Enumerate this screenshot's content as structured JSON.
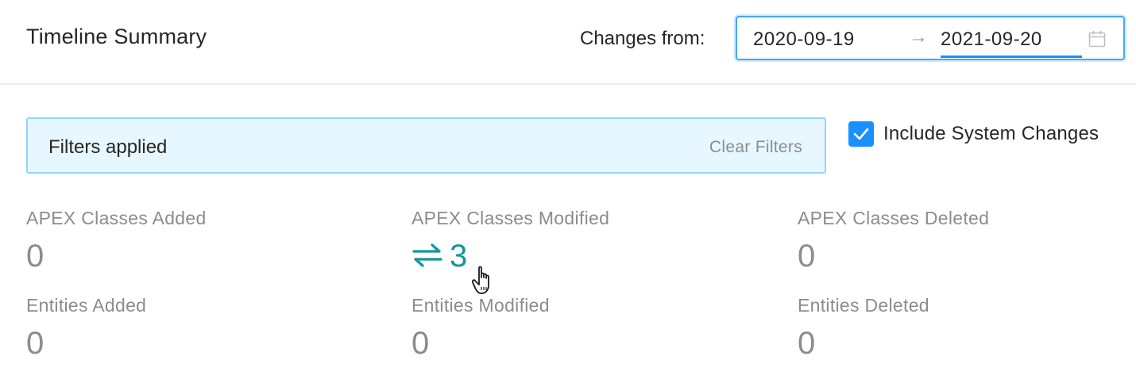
{
  "header": {
    "title": "Timeline Summary",
    "changes_label": "Changes from:",
    "range": {
      "start": "2020-09-19",
      "separator": "→",
      "end": "2021-09-20",
      "icon": "calendar-icon"
    }
  },
  "filters": {
    "message": "Filters applied",
    "clear_label": "Clear Filters"
  },
  "system_changes": {
    "label": "Include System Changes",
    "checked": true
  },
  "stats": [
    {
      "title": "APEX Classes Added",
      "value": "0"
    },
    {
      "title": "APEX Classes Modified",
      "value": "3",
      "icon": "swap-arrows-icon",
      "color": "#13959b"
    },
    {
      "title": "APEX Classes Deleted",
      "value": "0"
    },
    {
      "title": "Entities Added",
      "value": "0"
    },
    {
      "title": "Entities Modified",
      "value": "0"
    },
    {
      "title": "Entities Deleted",
      "value": "0"
    }
  ],
  "colors": {
    "accent": "#1890ff",
    "alert_bg": "#e6f7ff",
    "alert_border": "#91d5ff",
    "teal": "#13959b",
    "muted": "#8c8c8c"
  }
}
